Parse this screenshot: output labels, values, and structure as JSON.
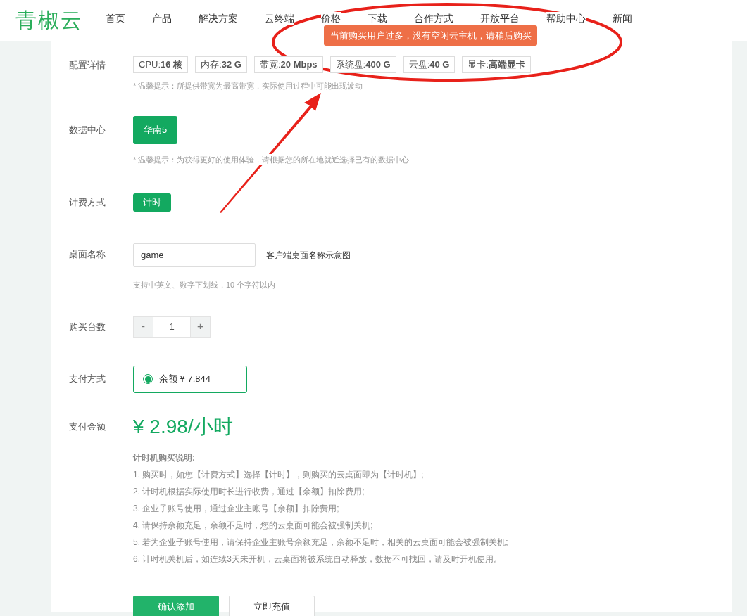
{
  "logo": "青椒云",
  "nav": [
    {
      "label": "首页"
    },
    {
      "label": "产品"
    },
    {
      "label": "解决方案"
    },
    {
      "label": "云终端"
    },
    {
      "label": "价格"
    },
    {
      "label": "下载"
    },
    {
      "label": "合作方式"
    },
    {
      "label": "开放平台"
    },
    {
      "label": "帮助中心"
    },
    {
      "label": "新闻"
    }
  ],
  "toast": "当前购买用户过多，没有空闲云主机，请稍后购买",
  "config": {
    "label": "配置详情",
    "specs": [
      {
        "name": "CPU:",
        "value": "16 核"
      },
      {
        "name": "内存:",
        "value": "32 G"
      },
      {
        "name": "带宽:",
        "value": "20 Mbps"
      },
      {
        "name": "系统盘:",
        "value": "400 G"
      },
      {
        "name": "云盘:",
        "value": "40 G"
      },
      {
        "name": "显卡:",
        "value": "高端显卡"
      }
    ],
    "tip": "* 温馨提示：所提供带宽为最高带宽，实际使用过程中可能出现波动"
  },
  "datacenter": {
    "label": "数据中心",
    "options": [
      {
        "label": "华南5",
        "selected": true
      }
    ],
    "tip": "* 温馨提示：为获得更好的使用体验，请根据您的所在地就近选择已有的数据中心"
  },
  "billing": {
    "label": "计费方式",
    "options": [
      {
        "label": "计时",
        "selected": true
      }
    ]
  },
  "desktop_name": {
    "label": "桌面名称",
    "value": "game",
    "link": "客户端桌面名称示意图",
    "hint": "支持中英文、数字下划线，10 个字符以内"
  },
  "quantity": {
    "label": "购买台数",
    "minus": "-",
    "value": "1",
    "plus": "+"
  },
  "payment": {
    "label": "支付方式",
    "options": [
      {
        "label": "余额 ¥ 7.844",
        "selected": true
      }
    ]
  },
  "amount": {
    "label": "支付金额",
    "value": "¥ 2.98/小时"
  },
  "notes": {
    "title": "计时机购买说明:",
    "items": [
      "1. 购买时，如您【计费方式】选择【计时】，则购买的云桌面即为【计时机】;",
      "2. 计时机根据实际使用时长进行收费，通过【余额】扣除费用;",
      "3. 企业子账号使用，通过企业主账号【余额】扣除费用;",
      "4. 请保持余额充足，余额不足时，您的云桌面可能会被强制关机;",
      "5. 若为企业子账号使用，请保持企业主账号余额充足，余额不足时，相关的云桌面可能会被强制关机;",
      "6. 计时机关机后，如连续3天未开机，云桌面将被系统自动释放，数据不可找回，请及时开机使用。"
    ]
  },
  "buttons": [
    {
      "label": "确认添加",
      "kind": "primary"
    },
    {
      "label": "立即充值",
      "kind": "secondary"
    }
  ]
}
